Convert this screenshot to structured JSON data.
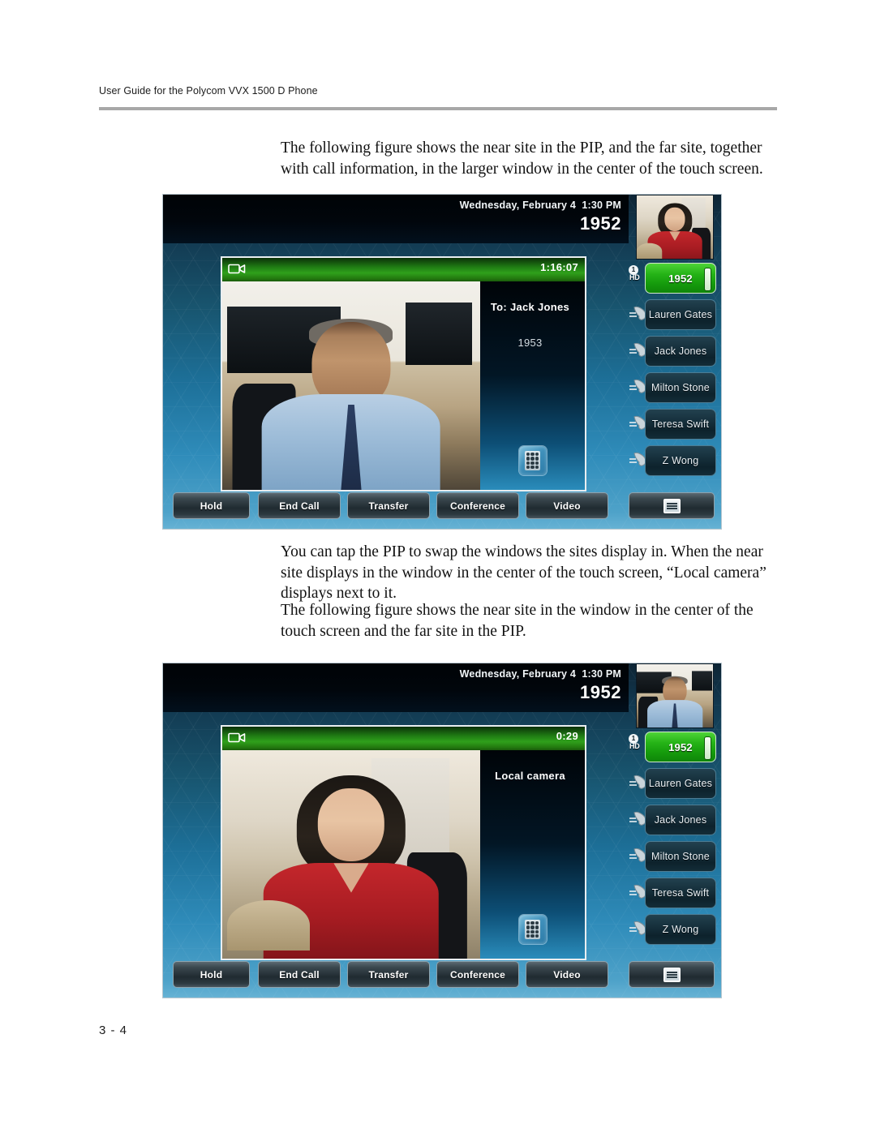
{
  "page": {
    "header": "User Guide for the Polycom VVX 1500 D Phone",
    "page_number": "3 - 4"
  },
  "paragraphs": {
    "p1": "The following figure shows the near site in the PIP, and the far site, together with call information, in the larger window in the center of the touch screen.",
    "p2": "You can tap the PIP to swap the windows the sites display in. When the near site displays in the window in the center of the touch screen, “Local camera” displays next to it.",
    "p3": "The following figure shows the near site in the window in the center of the touch screen and the far site in the PIP."
  },
  "colors": {
    "active_line_green": "#25b317",
    "title_bar_green": "#2fa01b",
    "screen_blue_dark": "#0d2434",
    "screen_blue_light": "#66b2d4",
    "status_bar_black": "#01060c"
  },
  "shared": {
    "status_bar": {
      "datetime": "Wednesday, February 4  1:30 PM",
      "extension": "1952"
    },
    "line_keys": [
      {
        "label": "1952",
        "badge_number": "1",
        "badge_hd": "HD",
        "state": "active",
        "icon": "hd-badge-icon"
      },
      {
        "label": "Lauren Gates",
        "state": "idle",
        "icon": "handset-icon"
      },
      {
        "label": "Jack Jones",
        "state": "idle",
        "icon": "handset-icon"
      },
      {
        "label": "Milton Stone",
        "state": "idle",
        "icon": "handset-icon"
      },
      {
        "label": "Teresa Swift",
        "state": "idle",
        "icon": "handset-icon"
      },
      {
        "label": "Z Wong",
        "state": "idle",
        "icon": "handset-icon"
      }
    ],
    "soft_keys": [
      {
        "label": "Hold",
        "icon": null
      },
      {
        "label": "End Call",
        "icon": null
      },
      {
        "label": "Transfer",
        "icon": null
      },
      {
        "label": "Conference",
        "icon": null
      },
      {
        "label": "Video",
        "icon": null
      },
      {
        "label": "",
        "icon": "menu-list-icon"
      }
    ],
    "dialpad_icon": "dialpad-icon",
    "camera_icon": "video-camera-icon"
  },
  "figure1": {
    "call": {
      "timer": "1:16:07",
      "to_label": "To: Jack Jones",
      "number": "1953"
    },
    "main_video_caption": "far-site-video",
    "pip_caption": "near-site-pip"
  },
  "figure2": {
    "call": {
      "timer": "0:29",
      "to_label": "Local camera",
      "number": ""
    },
    "main_video_caption": "near-site-video",
    "pip_caption": "far-site-pip"
  }
}
